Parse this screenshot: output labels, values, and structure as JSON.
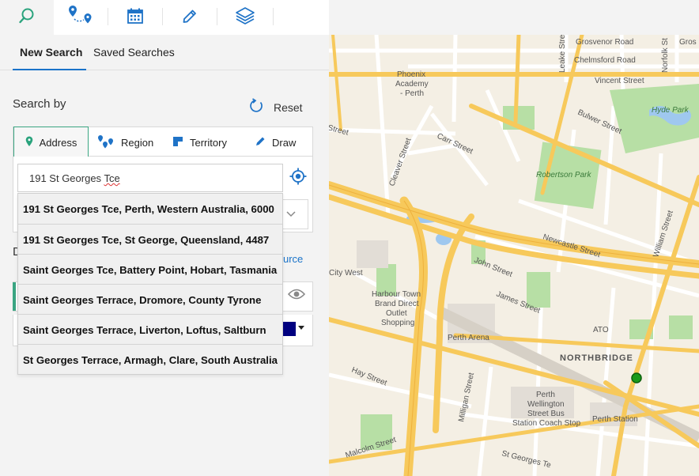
{
  "toolbar": {
    "icons": [
      "search-icon",
      "route-pins-icon",
      "calendar-icon",
      "pencil-icon",
      "layers-icon"
    ]
  },
  "tabs": {
    "new_search": "New Search",
    "saved_searches": "Saved Searches"
  },
  "search_by": {
    "label": "Search by",
    "reset_label": "Reset"
  },
  "modes": {
    "address": "Address",
    "region": "Region",
    "territory": "Territory",
    "draw": "Draw"
  },
  "address_input": {
    "value": "191 St Georges Tce",
    "prefix": "191 St Georges ",
    "flagged_word": "Tce"
  },
  "suggestions": [
    "191 St Georges Tce, Perth, Western Australia, 6000",
    "191 St Georges Tce, St George, Queensland, 4487",
    "Saint Georges Tce, Battery Point, Hobart, Tasmania",
    "Saint Georges Terrace, Dromore, County Tyrone",
    "Saint Georges Terrace, Liverton, Loftus, Saltburn",
    "St Georges Terrace, Armagh, Clare, South Australia"
  ],
  "partial": {
    "letter": "D",
    "source_link": "urce"
  },
  "colors": {
    "accent": "#1a73c9",
    "active_border": "#3aa582",
    "swatch": "#000080"
  },
  "map": {
    "streets": {
      "grosvenor": "Grosvenor Road",
      "gros": "Gros",
      "chelmsford": "Chelmsford Road",
      "vincent": "Vincent Street",
      "leake": "Leake Street",
      "norfolk": "Norfolk St",
      "bulwer": "Bulwer Street",
      "street_fragment": "Street",
      "cleaver": "Cleaver Street",
      "carr": "Carr Street",
      "newcastle": "Newcastle Street",
      "william": "William Street",
      "john": "John Street",
      "james": "James Street",
      "hay": "Hay Street",
      "milligan": "Milligan Street",
      "malcolm": "Malcolm Street",
      "st_georges": "St Georges Te"
    },
    "places": {
      "phoenix_1": "Phoenix",
      "phoenix_2": "Academy",
      "phoenix_3": "- Perth",
      "hyde_park": "Hyde Park",
      "robertson_park": "Robertson Park",
      "city_west": "City West",
      "harbour_1": "Harbour Town",
      "harbour_2": "Brand Direct",
      "harbour_3": "Outlet",
      "harbour_4": "Shopping",
      "perth_arena": "Perth Arena",
      "ato": "ATO",
      "northbridge": "NORTHBRIDGE",
      "wellington_1": "Perth",
      "wellington_2": "Wellington",
      "wellington_3": "Street Bus",
      "wellington_4": "Station Coach Stop",
      "perth_station": "Perth Station"
    }
  }
}
